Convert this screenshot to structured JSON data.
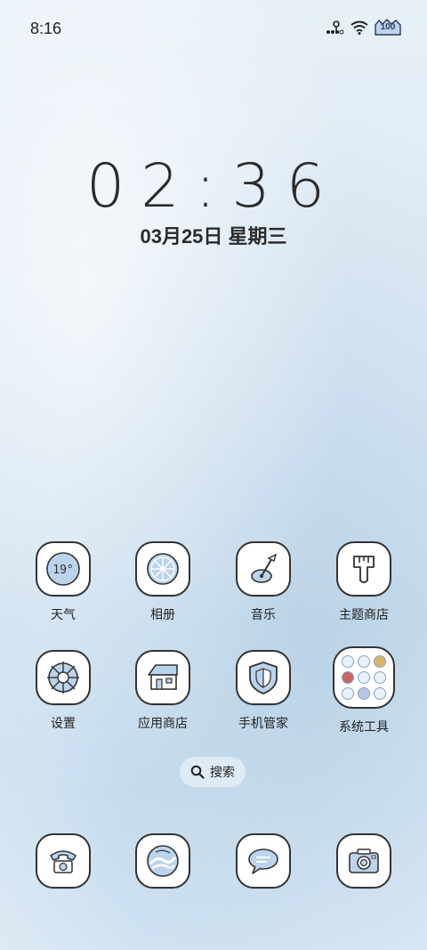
{
  "status_bar": {
    "time": "8:16",
    "battery_level": "100"
  },
  "clock": {
    "time": "02:36",
    "date": "03月25日 星期三"
  },
  "apps": [
    {
      "label": "天气",
      "icon": "weather-icon",
      "icon_text": "19°"
    },
    {
      "label": "相册",
      "icon": "gallery-icon"
    },
    {
      "label": "音乐",
      "icon": "music-icon"
    },
    {
      "label": "主题商店",
      "icon": "theme-store-icon"
    },
    {
      "label": "设置",
      "icon": "settings-icon"
    },
    {
      "label": "应用商店",
      "icon": "app-store-icon"
    },
    {
      "label": "手机管家",
      "icon": "phone-manager-icon"
    },
    {
      "label": "系统工具",
      "icon": "system-tools-folder-icon"
    }
  ],
  "search": {
    "label": "搜索",
    "icon": "search-icon"
  },
  "dock": [
    {
      "icon": "phone-icon"
    },
    {
      "icon": "browser-icon"
    },
    {
      "icon": "messages-icon"
    },
    {
      "icon": "camera-icon"
    }
  ],
  "colors": {
    "icon_fill": "#bcd3ec",
    "icon_stroke": "#333333",
    "background": "#dbe8f3"
  }
}
